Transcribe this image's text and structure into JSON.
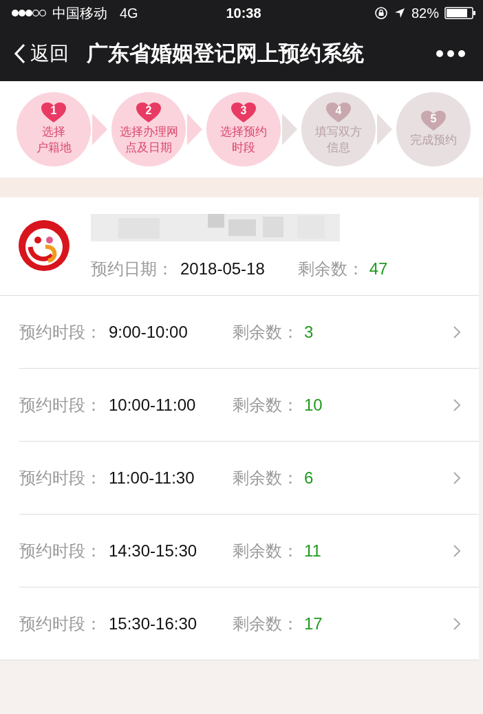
{
  "status_bar": {
    "carrier": "中国移动",
    "network": "4G",
    "time": "10:38",
    "battery": "82%"
  },
  "nav": {
    "back": "返回",
    "title": "广东省婚姻登记网上预约系统"
  },
  "steps": [
    {
      "number": "1",
      "lines": [
        "选择",
        "户籍地"
      ],
      "active": true
    },
    {
      "number": "2",
      "lines": [
        "选择办理网",
        "点及日期"
      ],
      "active": true
    },
    {
      "number": "3",
      "lines": [
        "选择预约",
        "时段"
      ],
      "active": true
    },
    {
      "number": "4",
      "lines": [
        "填写双方",
        "信息"
      ],
      "active": false
    },
    {
      "number": "5",
      "lines": [
        "完成预约"
      ],
      "active": false
    }
  ],
  "office": {
    "date_label": "预约日期：",
    "date": "2018-05-18",
    "remaining_label": "剩余数：",
    "remaining": "47"
  },
  "slots": [
    {
      "label": "预约时段：",
      "time": "9:00-10:00",
      "remaining_label": "剩余数：",
      "remaining": "3"
    },
    {
      "label": "预约时段：",
      "time": "10:00-11:00",
      "remaining_label": "剩余数：",
      "remaining": "10"
    },
    {
      "label": "预约时段：",
      "time": "11:00-11:30",
      "remaining_label": "剩余数：",
      "remaining": "6"
    },
    {
      "label": "预约时段：",
      "time": "14:30-15:30",
      "remaining_label": "剩余数：",
      "remaining": "11"
    },
    {
      "label": "预约时段：",
      "time": "15:30-16:30",
      "remaining_label": "剩余数：",
      "remaining": "17"
    }
  ]
}
